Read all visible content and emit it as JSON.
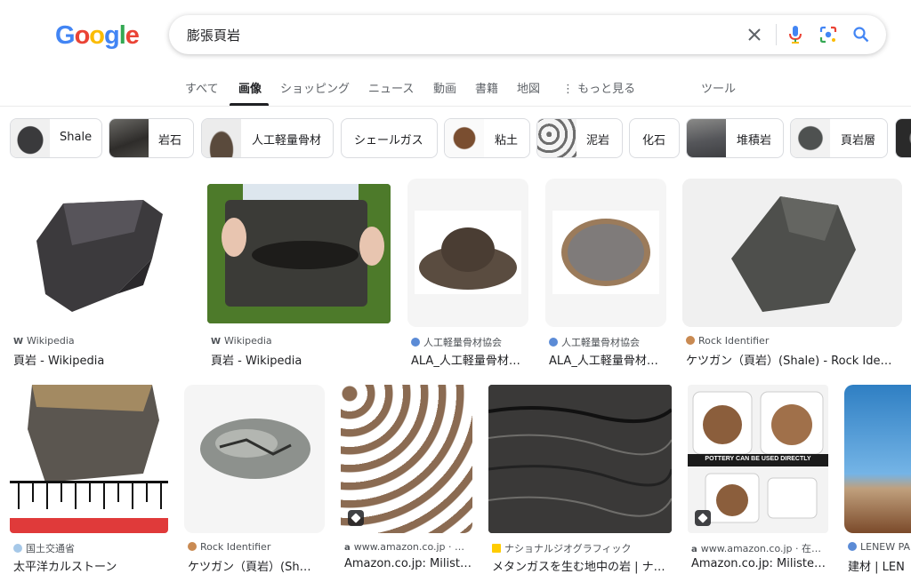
{
  "header": {
    "logo_letters": [
      "G",
      "o",
      "o",
      "g",
      "l",
      "e"
    ],
    "search_query": "膨張頁岩"
  },
  "tabs": [
    "すべて",
    "画像",
    "ショッピング",
    "ニュース",
    "動画",
    "書籍",
    "地図",
    "もっと見る",
    "ツール"
  ],
  "chips": [
    "Shale",
    "岩石",
    "人工軽量骨材",
    "シェールガス",
    "粘土",
    "泥岩",
    "化石",
    "堆積岩",
    "頁岩層"
  ],
  "results": [
    {
      "source": "Wikipedia",
      "title": "頁岩 - Wikipedia"
    },
    {
      "source": "Wikipedia",
      "title": "頁岩 - Wikipedia"
    },
    {
      "source": "人工軽量骨材協会",
      "title": "ALA_人工軽量骨材…"
    },
    {
      "source": "人工軽量骨材協会",
      "title": "ALA_人工軽量骨材…"
    },
    {
      "source": "Rock Identifier",
      "title": "ケツガン（頁岩）(Shale) - Rock Ide…"
    },
    {
      "source": "国土交通省",
      "title": "太平洋カルストーン"
    },
    {
      "source": "Rock Identifier",
      "title": "ケツガン（頁岩）(Sh…"
    },
    {
      "source": "www.amazon.co.jp · …",
      "title": "Amazon.co.jp: Milist…"
    },
    {
      "source": "ナショナルジオグラフィック",
      "title": "メタンガスを生む地中の岩 | ナ…"
    },
    {
      "source": "www.amazon.co.jp · 在…",
      "title": "Amazon.co.jp: Milisten…"
    },
    {
      "source": "LENEW PA",
      "title": "建材 | LEN"
    }
  ],
  "image_overlay_text": {
    "pottery": "POTTERY CAN BE USED DIRECTLY"
  },
  "colors": {
    "google_blue": "#4285f4",
    "google_red": "#ea4335",
    "google_yellow": "#fbbc05",
    "google_green": "#34a853"
  }
}
